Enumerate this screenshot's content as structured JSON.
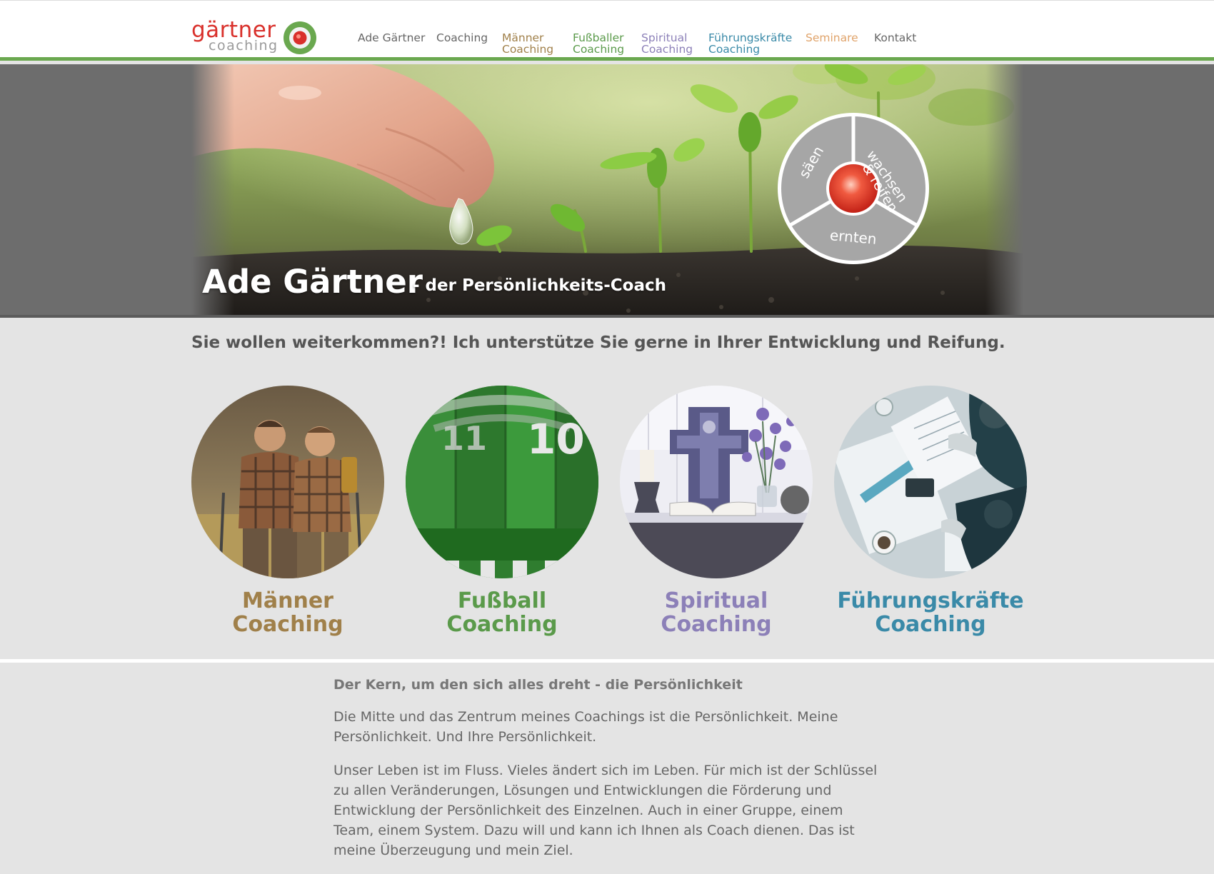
{
  "colors": {
    "header_bar": "#6aa84f",
    "logo_red": "#d9302b",
    "maenner": "#a0804a",
    "fussball": "#5a9a4a",
    "spiritual": "#8c80b8",
    "fuehrung": "#3a8aa8",
    "seminare": "#e0a36a"
  },
  "logo": {
    "word": "gärtner",
    "sub": "coaching",
    "icon": "target-circle-icon"
  },
  "nav": [
    {
      "line1": "",
      "line2": "Ade Gärtner",
      "color": "#666666"
    },
    {
      "line1": "",
      "line2": "Coaching",
      "color": "#666666"
    },
    {
      "line1": "Männer",
      "line2": "Coaching",
      "color": "#a0804a"
    },
    {
      "line1": "Fußballer",
      "line2": "Coaching",
      "color": "#5a9a4a"
    },
    {
      "line1": "Spiritual",
      "line2": "Coaching",
      "color": "#8c80b8"
    },
    {
      "line1": "Führungskräfte",
      "line2": "Coaching",
      "color": "#3a8aa8"
    },
    {
      "line1": "",
      "line2": "Seminare",
      "color": "#e0a36a"
    },
    {
      "line1": "",
      "line2": "Kontakt",
      "color": "#666666"
    }
  ],
  "hero": {
    "title": "Ade Gärtner",
    "subtitle": "- der Persönlichkeits-Coach",
    "wheel": {
      "segment_left": "säen",
      "segment_right_1": "wachsen",
      "segment_right_2": "& reifen",
      "segment_bottom": "ernten"
    }
  },
  "intro": "Sie wollen weiterkommen?! Ich unterstütze Sie gerne in Ihrer Entwicklung und Reifung.",
  "cards": [
    {
      "line1": "Männer",
      "line2": "Coaching",
      "color": "#a0804a",
      "image": "two-hikers-photo"
    },
    {
      "line1": "Fußball",
      "line2": "Coaching",
      "color": "#5a9a4a",
      "image": "football-team-huddle-photo"
    },
    {
      "line1": "Spiritual",
      "line2": "Coaching",
      "color": "#8c80b8",
      "image": "altar-crucifix-photo"
    },
    {
      "line1": "Führungskräfte",
      "line2": "Coaching",
      "color": "#3a8aa8",
      "image": "business-meeting-photo"
    }
  ],
  "content": {
    "heading": "Der Kern, um den sich alles dreht - die Persönlichkeit",
    "p1": "Die Mitte und das Zentrum meines Coachings ist die Persönlichkeit. Meine Persönlichkeit. Und Ihre Persönlichkeit.",
    "p2": "Unser Leben ist im Fluss. Vieles ändert sich im Leben. Für mich ist der Schlüssel zu allen Veränderungen, Lösungen und Entwicklungen die Förderung und Entwicklung der Persönlichkeit des Einzelnen. Auch in einer Gruppe, einem Team, einem System. Dazu will und kann ich Ihnen als Coach dienen. Das ist meine Überzeugung und mein Ziel."
  }
}
